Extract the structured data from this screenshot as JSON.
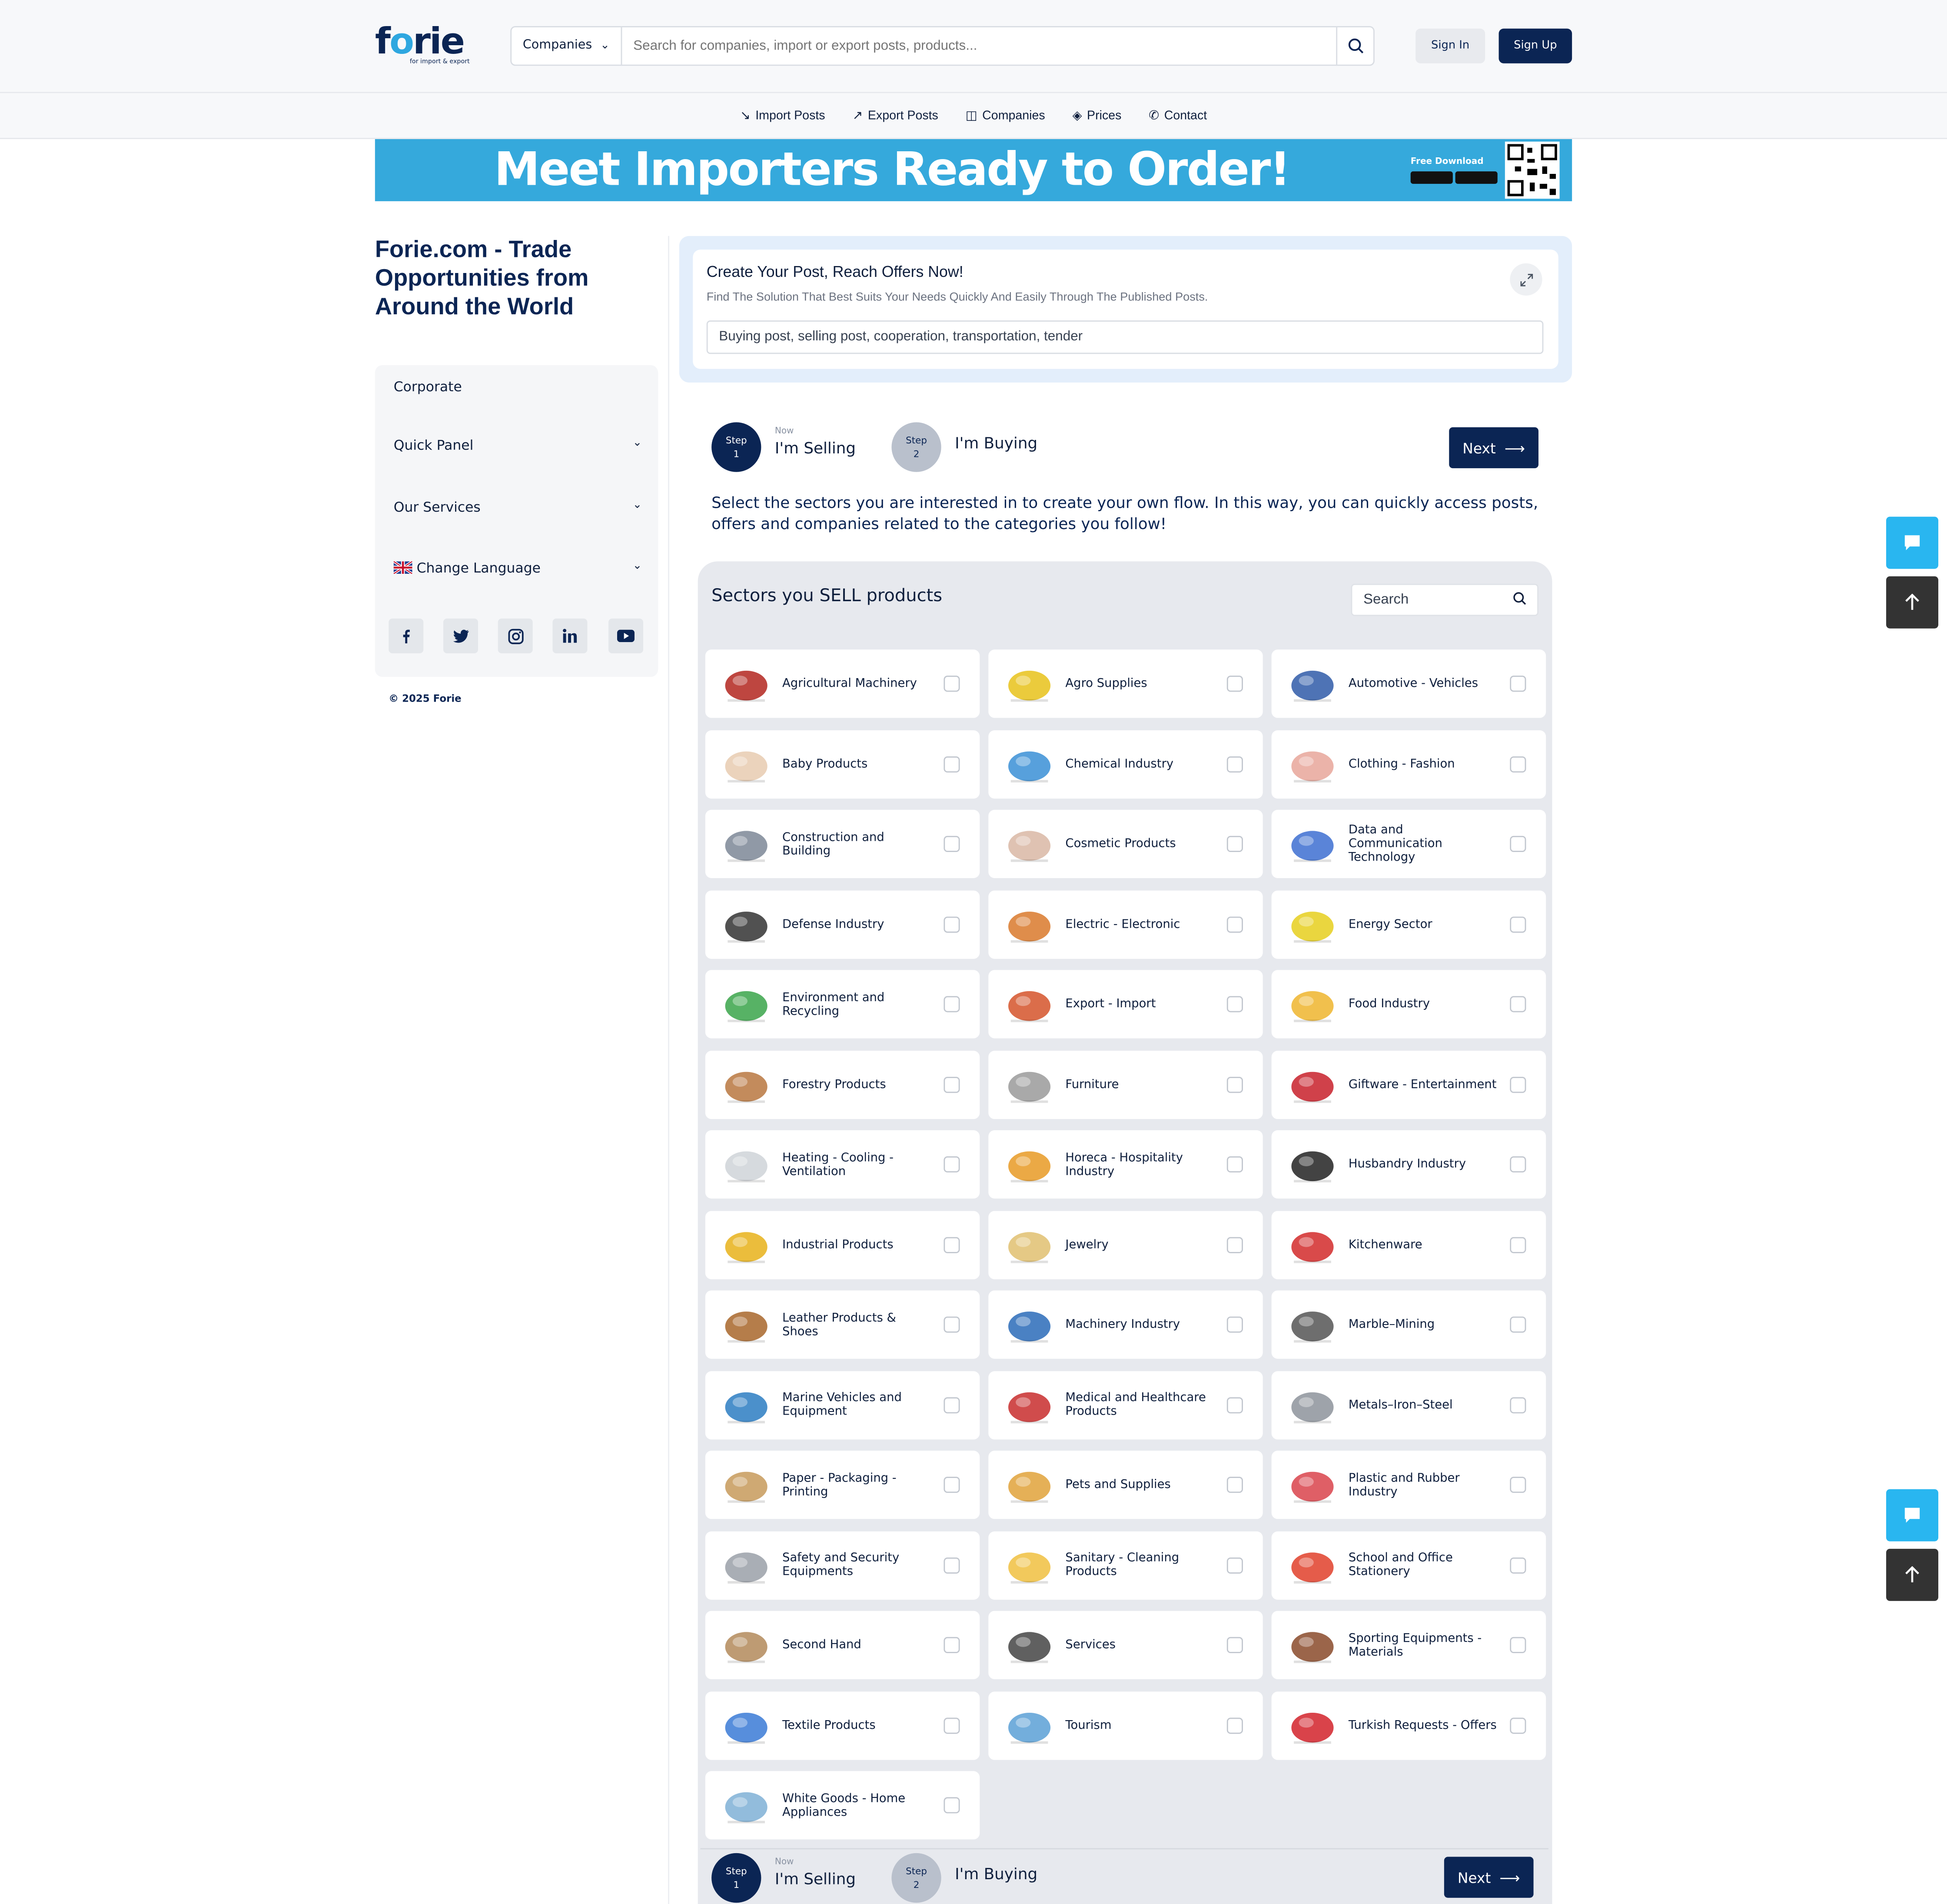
{
  "header": {
    "logo_text_1": "f",
    "logo_text_2": "o",
    "logo_text_3": "rie",
    "logo_tagline": "for import & export",
    "search_category": "Companies",
    "search_placeholder": "Search for companies, import or export posts, products...",
    "sign_in": "Sign In",
    "sign_up": "Sign Up"
  },
  "nav": [
    {
      "label": "Import Posts",
      "icon": "import-icon"
    },
    {
      "label": "Export Posts",
      "icon": "export-icon"
    },
    {
      "label": "Companies",
      "icon": "briefcase-icon"
    },
    {
      "label": "Prices",
      "icon": "tag-icon"
    },
    {
      "label": "Contact",
      "icon": "phone-icon"
    }
  ],
  "banner": {
    "headline": "Meet Importers Ready to Order!",
    "download": "Free Download"
  },
  "sidebar": {
    "title": "Forie.com - Trade Opportunities from Around the World",
    "items": [
      "Corporate",
      "Quick Panel",
      "Our Services",
      "Change Language"
    ],
    "social": [
      "facebook-icon",
      "twitter-icon",
      "instagram-icon",
      "linkedin-icon",
      "youtube-icon"
    ],
    "copyright": "© 2025 Forie"
  },
  "post": {
    "title": "Create Your Post, Reach Offers Now!",
    "subtitle": "Find The Solution That Best Suits Your Needs Quickly And Easily Through The Published Posts.",
    "input": "Buying post, selling post, cooperation, transportation, tender"
  },
  "steps": {
    "step1_word": "Step",
    "step1_num": "1",
    "now": "Now",
    "step1_label": "I'm Selling",
    "step2_word": "Step",
    "step2_num": "2",
    "step2_label": "I'm Buying",
    "next": "Next"
  },
  "description": "Select the sectors you are interested in to create your own flow. In this way, you can quickly access posts, offers and companies related to the categories you follow!",
  "sectors": {
    "title": "Sectors you SELL products",
    "search_placeholder": "Search",
    "items": [
      {
        "label": "Agricultural Machinery",
        "color": "#b3261e"
      },
      {
        "label": "Agro Supplies",
        "color": "#e8c21a"
      },
      {
        "label": "Automotive - Vehicles",
        "color": "#2f5aa8"
      },
      {
        "label": "Baby Products",
        "color": "#e8cbb0"
      },
      {
        "label": "Chemical Industry",
        "color": "#3a8fd6"
      },
      {
        "label": "Clothing - Fashion",
        "color": "#e8a69a"
      },
      {
        "label": "Construction and Building",
        "color": "#7c8797"
      },
      {
        "label": "Cosmetic Products",
        "color": "#d9b7a4"
      },
      {
        "label": "Data and Communication Technology",
        "color": "#3d6fd1"
      },
      {
        "label": "Defense Industry",
        "color": "#333333"
      },
      {
        "label": "Electric - Electronic",
        "color": "#d9792b"
      },
      {
        "label": "Energy Sector",
        "color": "#e6cf1d"
      },
      {
        "label": "Environment and Recycling",
        "color": "#3aa54a"
      },
      {
        "label": "Export - Import",
        "color": "#d5542a"
      },
      {
        "label": "Food Industry",
        "color": "#efb52e"
      },
      {
        "label": "Forestry Products",
        "color": "#b9773f"
      },
      {
        "label": "Furniture",
        "color": "#9a9a9a"
      },
      {
        "label": "Giftware - Entertainment",
        "color": "#c8202a"
      },
      {
        "label": "Heating - Cooling - Ventilation",
        "color": "#cfd3d8"
      },
      {
        "label": "Horeca - Hospitality Industry",
        "color": "#e89a25"
      },
      {
        "label": "Husbandry Industry",
        "color": "#222222"
      },
      {
        "label": "Industrial Products",
        "color": "#e8b21a"
      },
      {
        "label": "Jewelry",
        "color": "#e0c070"
      },
      {
        "label": "Kitchenware",
        "color": "#d22a2a"
      },
      {
        "label": "Leather Products & Shoes",
        "color": "#a8662a"
      },
      {
        "label": "Machinery Industry",
        "color": "#2a6bb8"
      },
      {
        "label": "Marble–Mining",
        "color": "#555555"
      },
      {
        "label": "Marine Vehicles and Equipment",
        "color": "#2c7cc2"
      },
      {
        "label": "Medical and Healthcare Products",
        "color": "#c82d2d"
      },
      {
        "label": "Metals–Iron–Steel",
        "color": "#8d939b"
      },
      {
        "label": "Paper - Packaging - Printing",
        "color": "#c79a5a"
      },
      {
        "label": "Pets and Supplies",
        "color": "#e0a23a"
      },
      {
        "label": "Plastic and Rubber Industry",
        "color": "#d9434b"
      },
      {
        "label": "Safety and Security Equipments",
        "color": "#9aa0a8"
      },
      {
        "label": "Sanitary - Cleaning Products",
        "color": "#f0c040"
      },
      {
        "label": "School and Office Stationery",
        "color": "#e0402a"
      },
      {
        "label": "Second Hand",
        "color": "#b38a5a"
      },
      {
        "label": "Services",
        "color": "#444444"
      },
      {
        "label": "Sporting Equipments - Materials",
        "color": "#8a4a2a"
      },
      {
        "label": "Textile Products",
        "color": "#3a7ad6"
      },
      {
        "label": "Tourism",
        "color": "#5aa0d6"
      },
      {
        "label": "Turkish Requests - Offers",
        "color": "#d2222a"
      },
      {
        "label": "White Goods - Home Appliances",
        "color": "#7fb0d6"
      }
    ]
  }
}
